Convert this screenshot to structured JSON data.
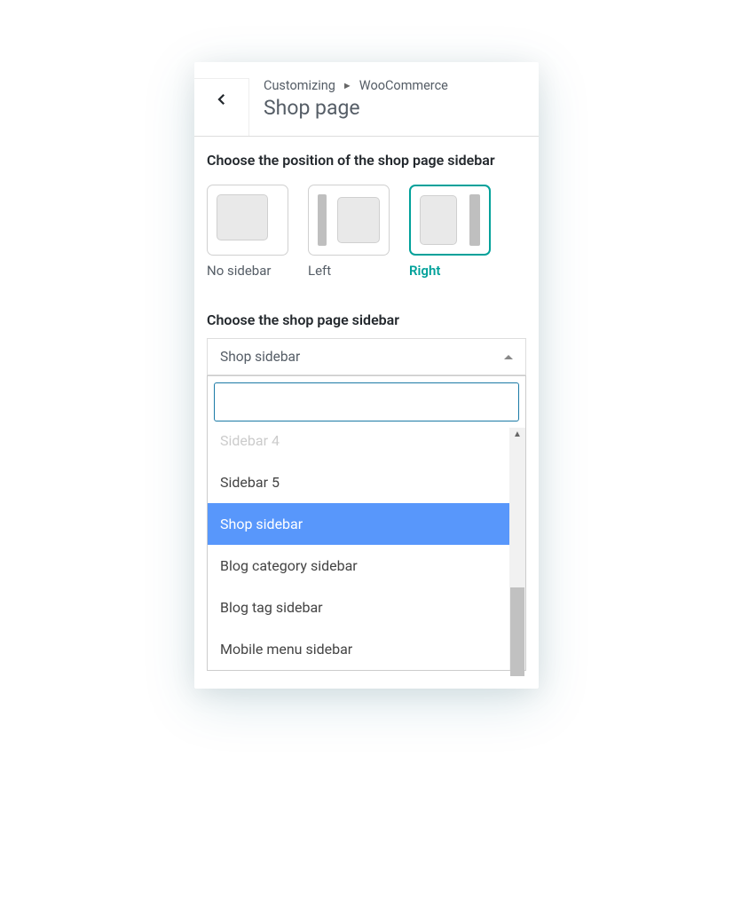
{
  "header": {
    "breadcrumb_root": "Customizing",
    "breadcrumb_section": "WooCommerce",
    "title": "Shop page"
  },
  "position_section": {
    "label": "Choose the position of the shop page sidebar",
    "options": {
      "none": "No sidebar",
      "left": "Left",
      "right": "Right"
    },
    "selected": "right"
  },
  "sidebar_section": {
    "label": "Choose the shop page sidebar",
    "selected_value": "Shop sidebar",
    "search_value": "",
    "dropdown_options": [
      {
        "label": "Sidebar 4",
        "partial": true
      },
      {
        "label": "Sidebar 5"
      },
      {
        "label": "Shop sidebar",
        "highlighted": true
      },
      {
        "label": "Blog category sidebar"
      },
      {
        "label": "Blog tag sidebar"
      },
      {
        "label": "Mobile menu sidebar"
      }
    ]
  },
  "colors": {
    "accent": "#00a19a",
    "highlight": "#5897fb"
  }
}
